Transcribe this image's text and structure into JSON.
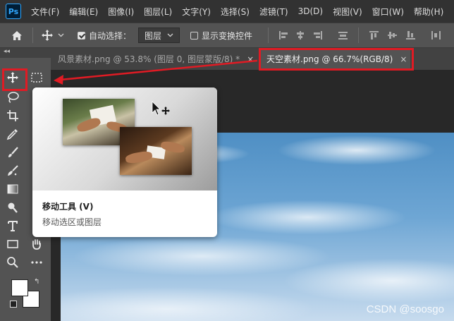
{
  "app": {
    "logo_text": "Ps",
    "menu": [
      "文件(F)",
      "编辑(E)",
      "图像(I)",
      "图层(L)",
      "文字(Y)",
      "选择(S)",
      "滤镜(T)",
      "3D(D)",
      "视图(V)",
      "窗口(W)",
      "帮助(H)"
    ]
  },
  "options_bar": {
    "auto_select_label": "自动选择：",
    "auto_select_checked": true,
    "auto_select_target": "图层",
    "show_transform_label": "显示变换控件",
    "show_transform_checked": false
  },
  "tabs": [
    {
      "label": "风景素材.png @ 53.8% (图层 0, 图层蒙版/8) *",
      "close": "×",
      "active": false
    },
    {
      "label": "天空素材.png @ 66.7%(RGB/8)",
      "close": "×",
      "active": true
    }
  ],
  "toolbar": {
    "collapse_label": "◂◂",
    "tools": [
      "move-tool",
      "marquee-tool",
      "lasso-tool",
      "crop-tool",
      "eyedropper-tool",
      "brush-tool",
      "healing-tool",
      "gradient-tool",
      "pen-tool",
      "type-tool",
      "rectangle-tool",
      "hand-tool",
      "zoom-tool",
      "more-tools"
    ],
    "foreground_color": "#ffffff",
    "background_color": "#ffffff"
  },
  "tooltip": {
    "title": "移动工具 (V)",
    "description": "移动选区或图层"
  },
  "watermark": "CSDN @soosgo",
  "colors": {
    "annotation_red": "#e01b24",
    "menu_bg": "#323232",
    "panel_bg": "#535353",
    "canvas_bg": "#282828"
  }
}
